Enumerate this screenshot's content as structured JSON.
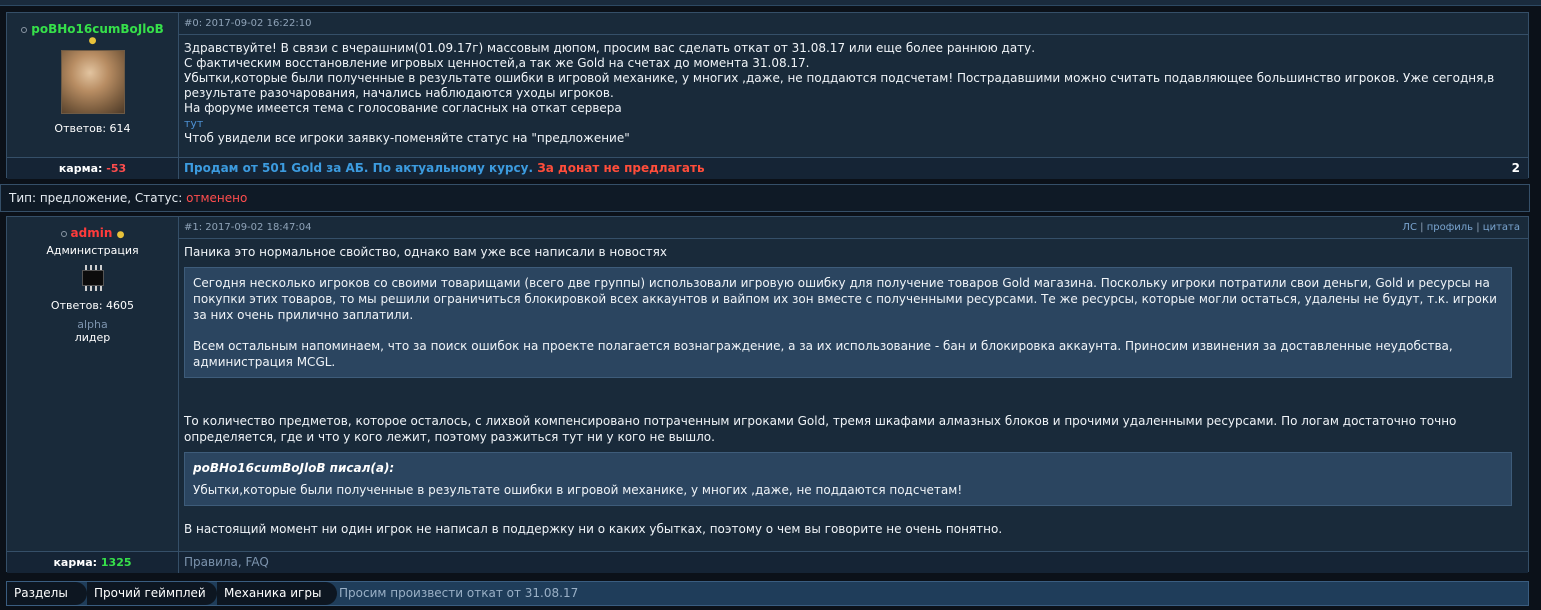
{
  "post1": {
    "author": "poBHo16cumBoJloB",
    "replies_label": "Ответов: 614",
    "meta": "#0: 2017-09-02 16:22:10",
    "lines": [
      "Здравствуйте! В связи с вчерашним(01.09.17г) массовым дюпом, просим вас сделать откат от 31.08.17 или еще более раннюю дату.",
      "С фактическим восстановление игровых ценностей,а так же Gold на счетах до момента 31.08.17.",
      "Убытки,которые были полученные в результате ошибки в игровой механике, у многих ,даже, не поддаются подсчетам! Пострадавшими можно считать подавляющее большинство игроков. Уже сегодня,в",
      "результате разочарования, начались наблюдаются уходы игроков.",
      "На форуме имеется тема с голосование согласных на откат сервера"
    ],
    "link": "тут",
    "last_line": "Чтоб увидели все игроки заявку-поменяйте статус на \"предложение\"",
    "karma_label": "карма:",
    "karma_value": "-53",
    "sig_blue": "Продам от 501 Gold за АБ. По актуальному курсу.",
    "sig_red": "За донат не предлагать",
    "sig_num": "2"
  },
  "status_bar": {
    "label": "Тип: предложение, Статус:",
    "value": "отменено"
  },
  "post2": {
    "author": "admin",
    "role": "Администрация",
    "replies_label": "Ответов: 4605",
    "group": "alpha",
    "rank": "лидер",
    "meta": "#1: 2017-09-02 18:47:04",
    "actions": {
      "pm": "ЛС",
      "profile": "профиль",
      "quote": "цитата",
      "sep": "|"
    },
    "intro": "Паника это нормальное свойство, однако вам уже все написали в новостях",
    "quote1_p1": "Сегодня несколько игроков со своими товарищами (всего две группы) использовали игровую ошибку для получение товаров Gold магазина. Поскольку игроки потратили свои деньги, Gold и ресурсы на покупки этих товаров, то мы решили ограничиться блокировкой всех аккаунтов и вайпом их зон вместе с полученными ресурсами. Те же ресурсы, которые могли остаться, удалены не будут, т.к. игроки за них очень прилично заплатили.",
    "quote1_p2": "Всем остальным напоминаем, что за поиск ошибок на проекте полагается вознаграждение, а за их использование - бан и блокировка аккаунта. Приносим извинения за доставленные неудобства, администрация MCGL.",
    "para1": "То количество предметов, которое осталось, с лихвой компенсировано потраченным игроками Gold, тремя шкафами алмазных блоков и прочими удаленными ресурсами. По логам достаточно точно определяется, где и что у кого лежит, поэтому разжиться тут ни у кого не вышло.",
    "quote2_title": "poBHo16cumBoJloB писал(а):",
    "quote2_text": "Убытки,которые были полученные в результате ошибки в игровой механике, у многих ,даже, не поддаются подсчетам!",
    "para2": "В настоящий момент ни один игрок не написал в поддержку ни о каких убытках, поэтому о чем вы говорите не очень понятно.",
    "karma_label": "карма:",
    "karma_value": "1325",
    "sig_rules": "Правила",
    "sig_comma": ",",
    "sig_faq": "FAQ"
  },
  "breadcrumbs": [
    "Разделы",
    "Прочий геймплей",
    "Механика игры",
    "Просим произвести откат от 31.08.17"
  ],
  "colors": {
    "accent_green": "#36e04a",
    "accent_red": "#ff4d4d",
    "link_blue": "#3c9bdf",
    "panel": "#192a3a"
  }
}
